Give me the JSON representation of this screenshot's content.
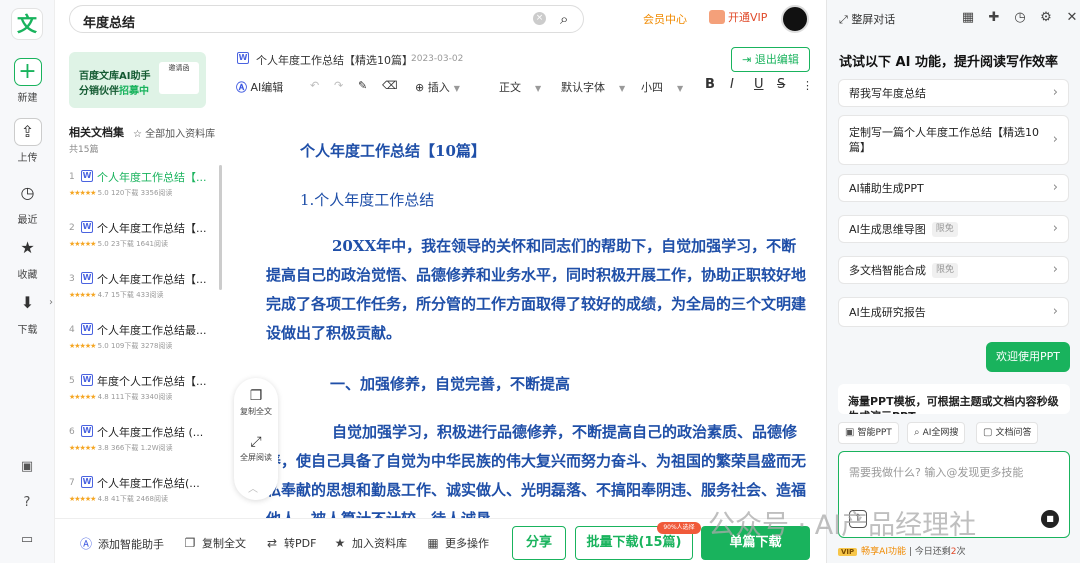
{
  "rail": {
    "logo": "文",
    "items": [
      {
        "label": "新建",
        "icon": "plus-icon"
      },
      {
        "label": "上传",
        "icon": "upload-icon"
      },
      {
        "label": "最近",
        "icon": "clock-icon"
      },
      {
        "label": "收藏",
        "icon": "star-icon"
      },
      {
        "label": "下载",
        "icon": "download-icon"
      }
    ]
  },
  "search": {
    "query": "年度总结"
  },
  "header": {
    "member_center": "会员中心",
    "open_vip": "开通VIP",
    "vip_badge": "VIP"
  },
  "banner": {
    "line1": "百度文库AI助手",
    "line2_prefix": "分销伙伴",
    "line2_highlight": "招募中",
    "card_text": "邀请函"
  },
  "collection": {
    "title": "相关文档集",
    "add_all": "全部加入资料库",
    "count": "共15篇",
    "items": [
      {
        "num": "1",
        "title": "个人年度工作总结【...",
        "rating": "5.0",
        "downloads": "120下载",
        "reads": "3356阅读",
        "active": true
      },
      {
        "num": "2",
        "title": "个人年度工作总结【...",
        "rating": "5.0",
        "downloads": "23下载",
        "reads": "1641阅读"
      },
      {
        "num": "3",
        "title": "个人年度工作总结【...",
        "rating": "4.7",
        "downloads": "15下载",
        "reads": "433阅读"
      },
      {
        "num": "4",
        "title": "个人年度工作总结最...",
        "rating": "5.0",
        "downloads": "109下载",
        "reads": "3278阅读"
      },
      {
        "num": "5",
        "title": "年度个人工作总结【...",
        "rating": "4.8",
        "downloads": "111下载",
        "reads": "3340阅读"
      },
      {
        "num": "6",
        "title": "个人年度工作总结 (...",
        "rating": "3.8",
        "downloads": "366下载",
        "reads": "1.2W阅读"
      },
      {
        "num": "7",
        "title": "个人年度工作总结(...",
        "rating": "4.8",
        "downloads": "41下载",
        "reads": "2468阅读"
      }
    ]
  },
  "document": {
    "file_badge": "W",
    "title": "个人年度工作总结【精选10篇】",
    "date": "2023-03-02",
    "exit_edit": "退出编辑",
    "toolbar": {
      "ai_edit": "AI编辑",
      "insert": "插入",
      "para_style": "正文",
      "font": "默认字体",
      "size": "小四"
    },
    "heading1": "个人年度工作总结【10篇】",
    "heading2": "1.个人年度工作总结",
    "para1": "20XX年中，我在领导的关怀和同志们的帮助下，自觉加强学习，不断提高自己的政治觉悟、品德修养和业务水平，同时积极开展工作，协助正职较好地完成了各项工作任务，所分管的工作方面取得了较好的成绩，为全局的三个文明建设做出了积极贡献。",
    "heading3": "一、加强修养，自觉完善，不断提高",
    "para2": "自觉加强学习，积极进行品德修养，不断提高自己的政治素质、品德修养，使自己具备了自觉为中华民族的伟大复兴而努力奋斗、为祖国的繁荣昌盛而无私奉献的思想和勤恳工作、诚实做人、光明磊落、不搞阳奉阴违、服务社会、造福他人、被人算计不计较、待人诚恳"
  },
  "float": {
    "copy_all": "复制全文",
    "fullscreen_read": "全屏阅读"
  },
  "bottom": {
    "ai_assistant": "添加智能助手",
    "copy_all": "复制全文",
    "to_pdf": "转PDF",
    "add_library": "加入资料库",
    "more": "更多操作",
    "share": "分享",
    "batch_download": "批量下载(15篇)",
    "batch_badge": "90%人选择",
    "single_download": "单篇下载"
  },
  "ai_panel": {
    "fullscreen_chat": "整屏对话",
    "heading": "试试以下 AI 功能，提升阅读写作效率",
    "options": [
      {
        "label": "帮我写年度总结"
      },
      {
        "label": "定制写一篇个人年度工作总结【精选10篇】"
      },
      {
        "label": "AI辅助生成PPT"
      },
      {
        "label": "AI生成思维导图",
        "tag": "限免"
      },
      {
        "label": "多文档智能合成",
        "tag": "限免"
      },
      {
        "label": "AI生成研究报告"
      }
    ],
    "welcome": "欢迎使用PPT",
    "reply": "海量PPT模板，可根据主题或文档内容秒级生成演示PPT",
    "chips": [
      "智能PPT",
      "AI全网搜",
      "文档问答"
    ],
    "input_placeholder": "需要我做什么? 输入@发现更多技能",
    "promo_badge": "VIP",
    "promo_highlight": "畅享AI功能",
    "promo_rest": "今日还剩",
    "promo_count": "2",
    "promo_unit": "次"
  },
  "watermark": "公众号 · AI产品经理社",
  "colors": {
    "brand_green": "#19b35d",
    "doc_blue": "#1f4fa8",
    "member_orange": "#f08a00"
  }
}
